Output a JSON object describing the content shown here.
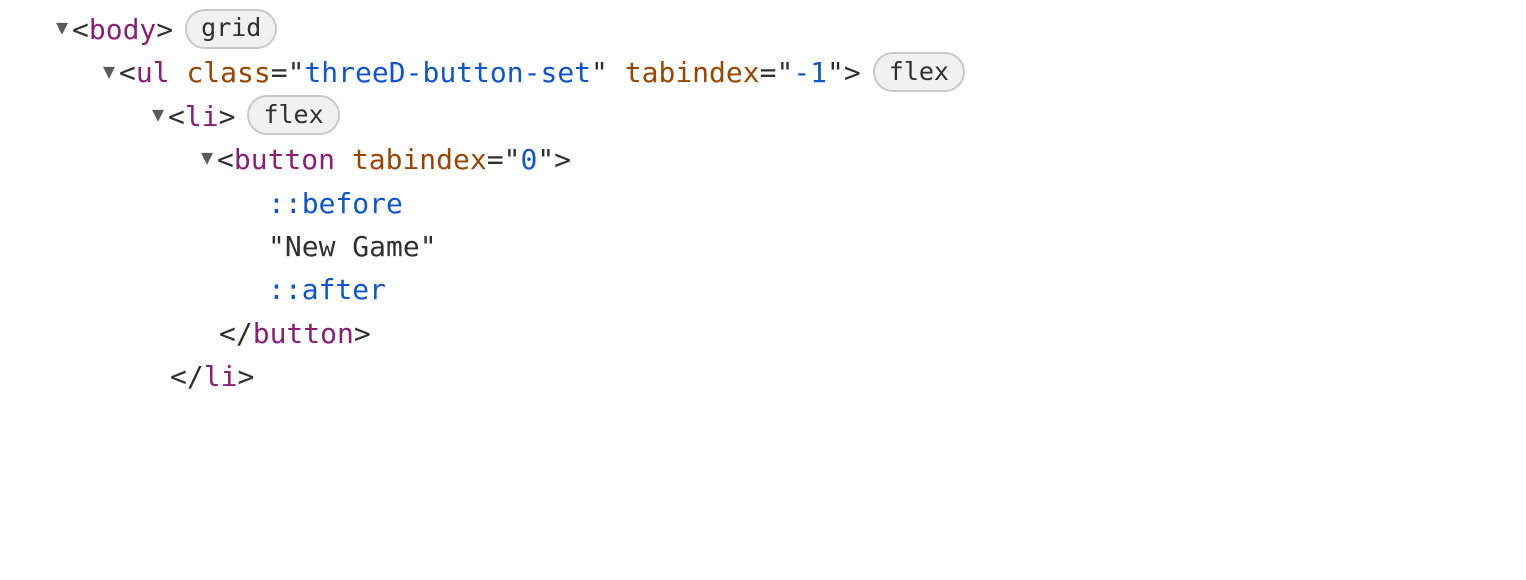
{
  "rows": {
    "body_open": {
      "tag": "body",
      "badge": "grid"
    },
    "ul_open": {
      "tag": "ul",
      "attrs": [
        {
          "name": "class",
          "value": "threeD-button-set"
        },
        {
          "name": "tabindex",
          "value": "-1"
        }
      ],
      "badge": "flex"
    },
    "li_open": {
      "tag": "li",
      "badge": "flex"
    },
    "button_open": {
      "tag": "button",
      "attrs": [
        {
          "name": "tabindex",
          "value": "0"
        }
      ]
    },
    "before": "::before",
    "text_node": "\"New Game\"",
    "after": "::after",
    "button_close": {
      "tag": "button"
    },
    "li_close": {
      "tag": "li"
    }
  }
}
